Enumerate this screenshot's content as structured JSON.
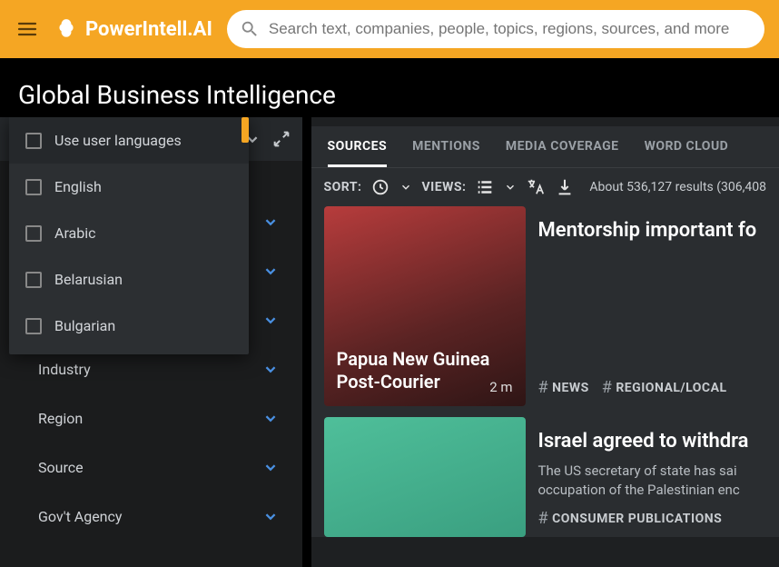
{
  "brand": "PowerIntell.AI",
  "search": {
    "placeholder": "Search text, companies, people, topics, regions, sources, and more"
  },
  "page_title": "Global Business Intelligence",
  "dropdown": {
    "primary": "Use user languages",
    "items": [
      "English",
      "Arabic",
      "Belarusian",
      "Bulgarian"
    ]
  },
  "filters": [
    "Industry",
    "Region",
    "Source",
    "Gov't Agency"
  ],
  "tabs": [
    "SOURCES",
    "MENTIONS",
    "MEDIA COVERAGE",
    "WORD CLOUD"
  ],
  "toolbar": {
    "sort_label": "SORT:",
    "views_label": "VIEWS:",
    "results": "About 536,127 results (306,408"
  },
  "cards": [
    {
      "source": "Papua New Guinea Post-Courier",
      "time": "2 m",
      "title": "Mentorship important fo",
      "tags": [
        "NEWS",
        "REGIONAL/LOCAL"
      ]
    },
    {
      "title": "Israel agreed to withdra",
      "desc": "The US secretary of state has sai occupation of the Palestinian enc",
      "tags": [
        "CONSUMER PUBLICATIONS"
      ]
    }
  ]
}
